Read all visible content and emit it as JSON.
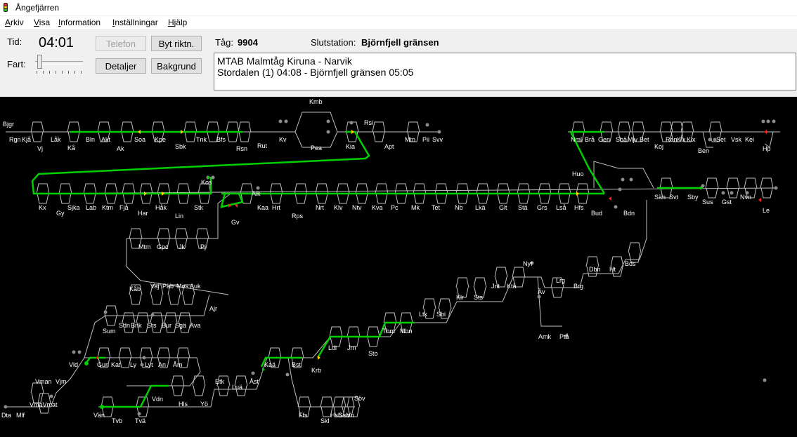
{
  "window": {
    "title": "Ångefjärren"
  },
  "menu": [
    "Arkiv",
    "Visa",
    "Information",
    "Inställningar",
    "Hjälp"
  ],
  "controls": {
    "time_label": "Tid:",
    "time_value": "04:01",
    "speed_label": "Fart:",
    "telefon": "Telefon",
    "byt_riktn": "Byt riktn.",
    "detaljer": "Detaljer",
    "bakgrund": "Bakgrund",
    "train_label": "Tåg:",
    "train_value": "9904",
    "dest_label": "Slutstation:",
    "dest_value": "Björnfjell gränsen"
  },
  "info": {
    "line1": "MTAB Malmtåg Kiruna - Narvik",
    "line2": "Stordalen (1) 04:08 - Björnfjell gränsen 05:05"
  },
  "map": {
    "stations": [
      "Bjgr",
      "Rgn",
      "Kjå",
      "Vj",
      "Låk",
      "Kå",
      "Bln",
      "Akt",
      "Ak",
      "Soa",
      "Kpe",
      "Sbk",
      "Tnk",
      "Bfs",
      "Rsn",
      "Rut",
      "Kv",
      "Kmb",
      "Pea",
      "Rsi",
      "Kia",
      "Apt",
      "Mtn",
      "Pii",
      "Svv",
      "Nml",
      "Brå",
      "Gen",
      "Sbä",
      "Mjv",
      "Bet",
      "Koj",
      "Ran",
      "Klx",
      "Klx",
      "Ben",
      "Set",
      "Vsk",
      "Kei",
      "Hp",
      "Huo",
      "Kos",
      "Kx",
      "Gy",
      "Sjka",
      "Lab",
      "Ktm",
      "Fjå",
      "Har",
      "Håk",
      "Lin",
      "Stk",
      "Aik",
      "Gv",
      "Kaa",
      "Hrt",
      "Rps",
      "Nrt",
      "Klv",
      "Ntv",
      "Kva",
      "Pc",
      "Mk",
      "Tet",
      "Nb",
      "Lkä",
      "Glt",
      "Stä",
      "Grs",
      "Lså",
      "Hfs",
      "Bud",
      "Bdn",
      "Sän",
      "Svt",
      "Sby",
      "Sus",
      "Gst",
      "Nvn",
      "Le",
      "Mtm",
      "Gpc",
      "Jk",
      "Pj",
      "Kåb",
      "Vaj",
      "Päb",
      "Mos",
      "Auk",
      "Ajr",
      "Sum",
      "Sdn",
      "Bnk",
      "Srs",
      "Bur",
      "Sgä",
      "Ava",
      "Vld",
      "Gun",
      "Kat",
      "Ly",
      "Lyt",
      "An",
      "Åm",
      "Vman",
      "Vjm",
      "VmaVmat",
      "Dta",
      "Mlf",
      "Vän",
      "Tvb",
      "Tvä",
      "Vdn",
      "Hls",
      "Yö",
      "Etk",
      "Luä",
      "Åst",
      "Kaä",
      "Bst",
      "Krb",
      "Ldl",
      "Jrn",
      "Sto",
      "Thm",
      "Mhn",
      "Ltk",
      "Sbi",
      "Klr",
      "Sts",
      "Jnt",
      "Ktä",
      "Nyf",
      "Äv",
      "Lrg",
      "Brg",
      "Dbn",
      "Ht",
      "Bds",
      "Amk",
      "Ptå",
      "Ffs",
      "Skl",
      "Hsb",
      "Gsb",
      "Vn",
      "Söv"
    ]
  },
  "colors": {
    "active_route": "#00d000",
    "track": "#bfbfbf",
    "signal_red": "#ff2020",
    "signal_yellow": "#ffd000",
    "dot": "#8c8c8c"
  }
}
